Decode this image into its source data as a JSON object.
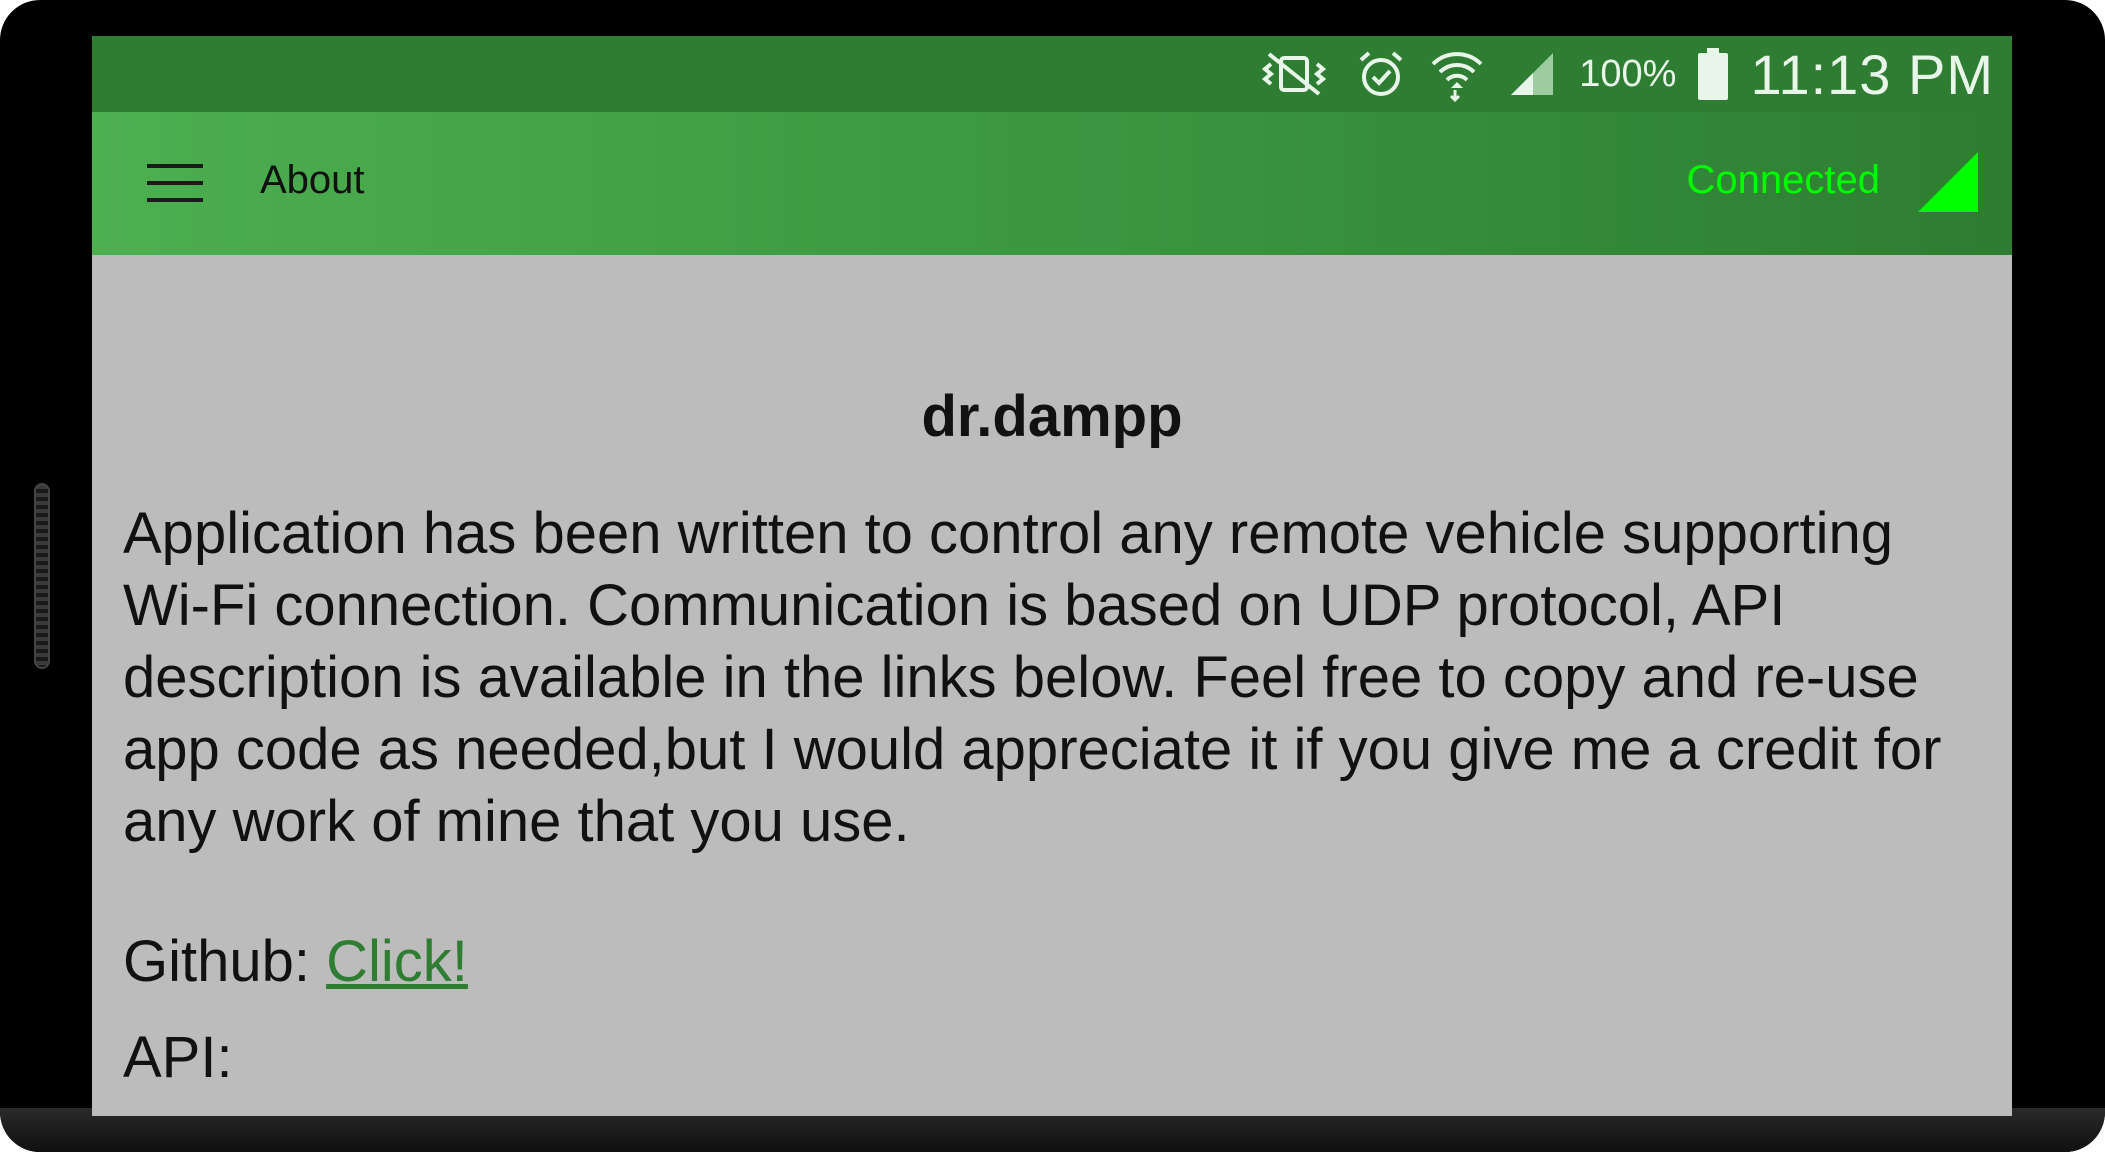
{
  "status_bar": {
    "battery_percent": "100%",
    "time": "11:13 PM",
    "icons": [
      "vibrate-mute-icon",
      "alarm-icon",
      "wifi-icon",
      "cell-signal-icon",
      "battery-icon"
    ]
  },
  "app_bar": {
    "title": "About",
    "menu_icon": "hamburger-menu-icon",
    "connection_status": "Connected",
    "connection_icon": "signal-triangle-icon"
  },
  "content": {
    "heading": "dr.dampp",
    "description": "Application has been written to control any remote vehicle supporting Wi-Fi connection. Communication is based on UDP protocol, API description is available in the links below. Feel free to copy and re-use app code as needed,but I would appreciate it if you give me a credit for any work of mine that you use.",
    "github_label": "Github: ",
    "github_link": "Click!",
    "api_label": "API:"
  },
  "colors": {
    "status_bar": "#2e7d32",
    "app_bar_start": "#4caf50",
    "app_bar_end": "#2e7d32",
    "connected": "#00ff00",
    "background": "#bcbcbc",
    "link": "#2e7d32"
  }
}
